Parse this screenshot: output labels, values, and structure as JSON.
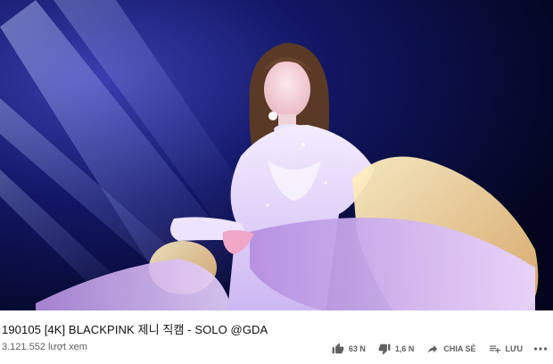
{
  "video": {
    "title": "190105 [4K] BLACKPINK 제니 직캠 - SOLO @GDA",
    "view_count": "3.121.552 lượt xem",
    "frame_description_icon": "video-frame"
  },
  "actions": {
    "like_count": "63 N",
    "dislike_count": "1,6 N",
    "share_label": "CHIA SẺ",
    "save_label": "LƯU"
  },
  "icons": {
    "like": "thumbs-up-icon",
    "dislike": "thumbs-down-icon",
    "share": "share-arrow-icon",
    "save": "playlist-add-icon",
    "more": "more-horizontal-icon"
  },
  "colors": {
    "text_primary": "#0f0f0f",
    "text_secondary": "#606060",
    "stage_background": "#05082a",
    "spotlight": "#8fa4ff"
  }
}
